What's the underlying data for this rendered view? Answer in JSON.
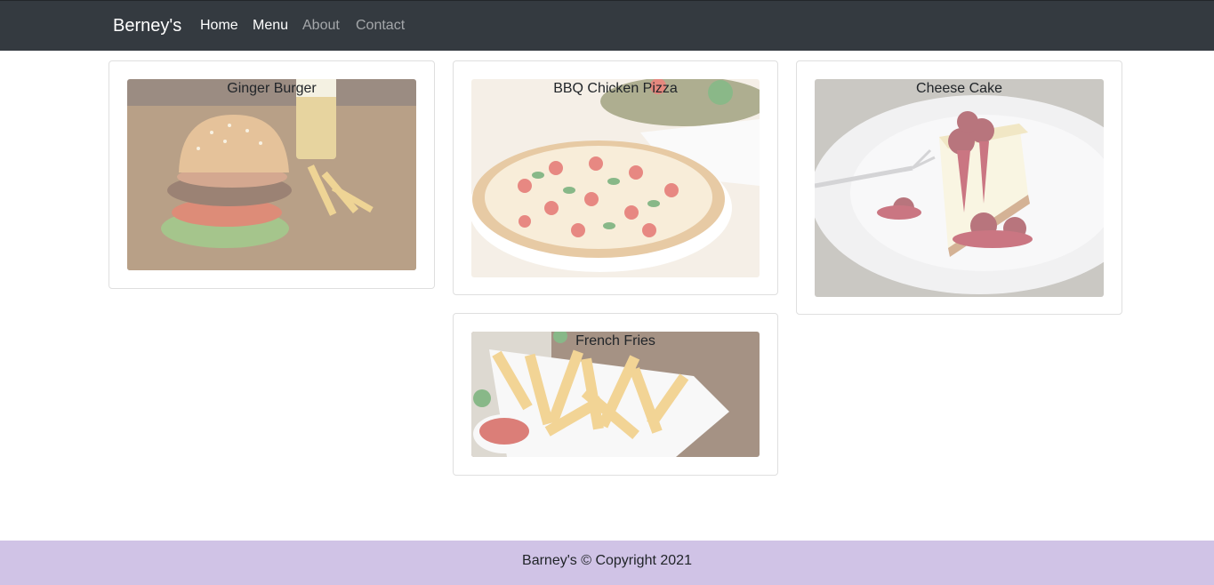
{
  "navbar": {
    "brand": "Berney's",
    "links": [
      {
        "label": "Home"
      },
      {
        "label": "Menu"
      },
      {
        "label": "About"
      },
      {
        "label": "Contact"
      }
    ]
  },
  "cards": [
    {
      "title": "Ginger Burger",
      "image": "burger-photo"
    },
    {
      "title": "BBQ Chicken Pizza",
      "image": "pizza-photo"
    },
    {
      "title": "Cheese Cake",
      "image": "cheesecake-photo"
    },
    {
      "title": "French Fries",
      "image": "fries-photo"
    }
  ],
  "footer": {
    "text": "Barney's © Copyright 2021"
  }
}
